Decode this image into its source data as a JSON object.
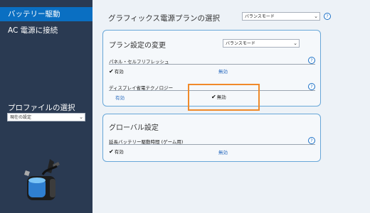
{
  "sidebar": {
    "items": [
      {
        "label": "バッテリー駆動"
      },
      {
        "label": "AC 電源に接続"
      }
    ],
    "profile_label": "プロファイルの選択",
    "profile_value": "現在の設定"
  },
  "main": {
    "graphics_plan_label": "グラフィックス電源プランの選択",
    "graphics_plan_value": "バランスモード",
    "plan_panel": {
      "title": "プラン設定の変更",
      "plan_value": "バランスモード",
      "panel_self_refresh": {
        "label": "パネル・セルフリフレッシュ",
        "on_label": "有効",
        "off_label": "無効",
        "selected": "on"
      },
      "display_power": {
        "label": "ディスプレイ省電テクノロジー",
        "on_label": "有効",
        "off_label": "無効",
        "selected": "off"
      }
    },
    "global_panel": {
      "title": "グローバル設定",
      "extended_battery": {
        "label": "延長バッテリー駆動時間 (ゲーム用)",
        "on_label": "有効",
        "off_label": "無効",
        "selected": "on"
      }
    }
  },
  "icons": {
    "help": "question-mark-icon",
    "check": "check-mark-icon",
    "dropdown": "chevron-down-icon",
    "battery": "battery-plug-icon"
  },
  "colors": {
    "sidebar_bg": "#2a3a52",
    "active_nav": "#0a6fc2",
    "panel_border": "#68a7d8",
    "link": "#2a6bbf",
    "highlight": "#f08a2a"
  },
  "glyphs": {
    "help": "?",
    "check": "✔",
    "chevron": "⌄"
  }
}
